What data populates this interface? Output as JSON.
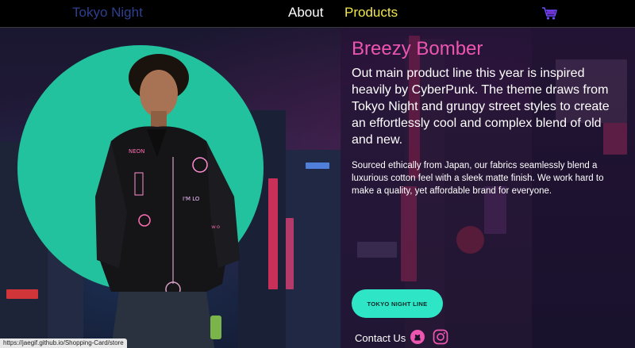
{
  "nav": {
    "brand": "Tokyo Night",
    "about": "About",
    "products": "Products",
    "cart_icon": "shopping-cart-icon"
  },
  "product": {
    "title": "Breezy Bomber",
    "lead": "Out main product line this year is inspired heavily by CyberPunk. The theme draws from Tokyo Night and grungy street styles to create an effortlessly cool and complex blend of old and new.",
    "detail": "Sourced ethically from Japan, our fabrics seamlessly blend a luxurious cotton feel with a sleek matte finish. We work hard to make a quality, yet affordable brand for everyone.",
    "cta_label": "TOKYO NIGHT LINE"
  },
  "footer": {
    "contact": "Contact Us",
    "github_icon": "github-icon",
    "instagram_icon": "instagram-icon"
  },
  "status": {
    "url": "https://jaegif.github.io/Shopping-Card/store"
  },
  "colors": {
    "nav_bg": "#000000",
    "brand": "#2f3f8f",
    "active_link": "#f2e64a",
    "title_pink": "#ee55b0",
    "teal": "#23c29f",
    "cta": "#2ee5c6"
  }
}
